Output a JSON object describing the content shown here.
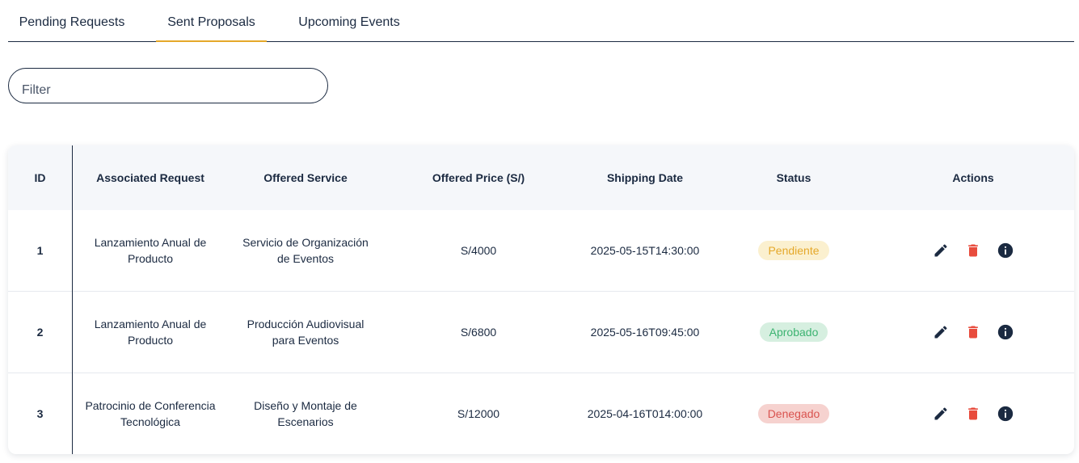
{
  "tabs": [
    {
      "label": "Pending Requests"
    },
    {
      "label": "Sent Proposals"
    },
    {
      "label": "Upcoming Events"
    }
  ],
  "filter": {
    "placeholder": "Filter",
    "value": ""
  },
  "table": {
    "headers": {
      "id": "ID",
      "request": "Associated Request",
      "service": "Offered Service",
      "price": "Offered Price (S/)",
      "date": "Shipping Date",
      "status": "Status",
      "actions": "Actions"
    },
    "rows": [
      {
        "id": "1",
        "request": "Lanzamiento Anual de Producto",
        "service": "Servicio de Organización de Eventos",
        "price": "S/4000",
        "date": "2025-05-15T14:30:00",
        "status": "Pendiente",
        "status_fg": "#e5a82a",
        "status_bg": "#fbf0cf"
      },
      {
        "id": "2",
        "request": "Lanzamiento Anual de Producto",
        "service": "Producción Audiovisual para Eventos",
        "price": "S/6800",
        "date": "2025-05-16T09:45:00",
        "status": "Aprobado",
        "status_fg": "#3cb371",
        "status_bg": "#d6efe0"
      },
      {
        "id": "3",
        "request": "Patrocinio de Conferencia Tecnológica",
        "service": "Diseño y Montaje de Escenarios",
        "price": "S/12000",
        "date": "2025-04-16T014:00:00",
        "status": "Denegado",
        "status_fg": "#d9534f",
        "status_bg": "#f6d2cf"
      }
    ]
  },
  "actions": {
    "edit_icon": "pencil-icon",
    "delete_icon": "trash-icon",
    "info_icon": "info-icon"
  },
  "colors": {
    "accent": "#e5a82a",
    "primary": "#1b2a41",
    "danger": "#e84c3d"
  }
}
